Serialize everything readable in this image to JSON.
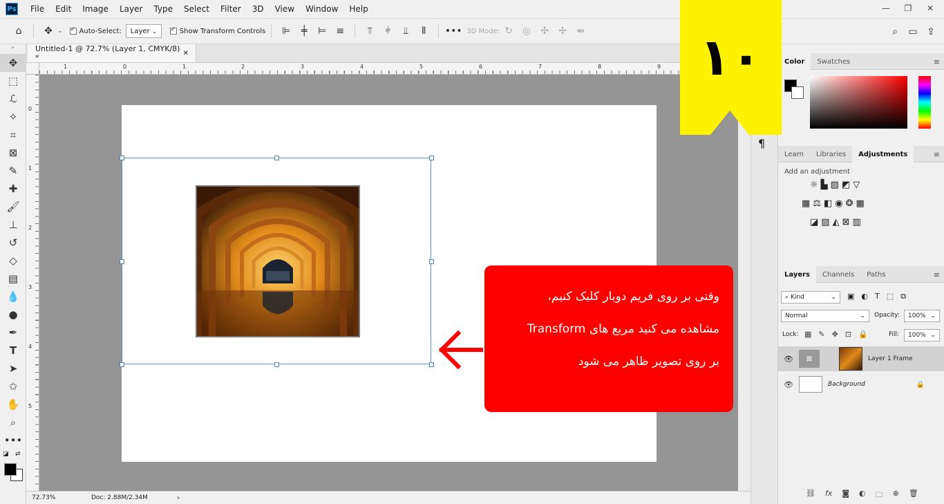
{
  "app": {
    "logo": "Ps",
    "menu": [
      "File",
      "Edit",
      "Image",
      "Layer",
      "Type",
      "Select",
      "Filter",
      "3D",
      "View",
      "Window",
      "Help"
    ]
  },
  "options": {
    "auto_select_label": "Auto-Select:",
    "auto_select_checked": true,
    "auto_select_target": "Layer",
    "show_transform_label": "Show Transform Controls",
    "show_transform_checked": true,
    "mode_3d_label": "3D Mode:"
  },
  "document": {
    "tab_title": "Untitled-1 @ 72.7% (Layer 1, CMYK/8) *",
    "h_ruler_labels": [
      "1",
      "0",
      "1",
      "2",
      "3",
      "4",
      "5",
      "6",
      "7",
      "8",
      "9"
    ],
    "v_ruler_labels": [
      "0",
      "1",
      "2",
      "3",
      "4",
      "5"
    ]
  },
  "status": {
    "zoom": "72.73%",
    "doc_size": "Doc: 2.88M/2.34M"
  },
  "badge": {
    "number": "۱۰",
    "color": "#fff200"
  },
  "callout": {
    "line1": "وقتی بر روی فریم دوبار کلیک کنیم،",
    "line2": "مشاهده می کنید مربع های Transform",
    "line3": "بر روی تصویر ظاهر می شود",
    "color": "#ff0000"
  },
  "color_panel": {
    "tabs": [
      "Color",
      "Swatches"
    ],
    "active_tab": "Color"
  },
  "adjust_panel": {
    "tabs": [
      "Learn",
      "Libraries",
      "Adjustments"
    ],
    "active_tab": "Adjustments",
    "subtitle": "Add an adjustment"
  },
  "layers_panel": {
    "tabs": [
      "Layers",
      "Channels",
      "Paths"
    ],
    "active_tab": "Layers",
    "filter_kind": "Kind",
    "blend_mode": "Normal",
    "opacity_label": "Opacity:",
    "opacity_value": "100%",
    "lock_label": "Lock:",
    "fill_label": "Fill:",
    "fill_value": "100%",
    "layers": [
      {
        "name": "Layer 1 Frame",
        "selected": true,
        "locked": false
      },
      {
        "name": "Background",
        "selected": false,
        "locked": true
      }
    ]
  }
}
